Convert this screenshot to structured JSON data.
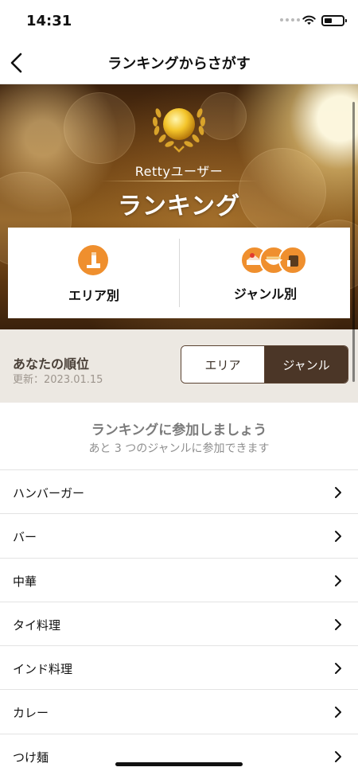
{
  "status_bar": {
    "time": "14:31"
  },
  "nav": {
    "title": "ランキングからさがす"
  },
  "hero": {
    "subtitle": "Rettyユーザー",
    "title": "ランキング",
    "choices": [
      {
        "label": "エリア別",
        "icon": "area-map-icon"
      },
      {
        "label": "ジャンル別",
        "icon": "food-genre-icon"
      }
    ]
  },
  "rank": {
    "title": "あなたの順位",
    "updated": "更新：2023.01.15",
    "tabs": [
      {
        "label": "エリア",
        "selected": false
      },
      {
        "label": "ジャンル",
        "selected": true
      }
    ]
  },
  "join": {
    "title": "ランキングに参加しましょう",
    "subtitle": "あと 3 つのジャンルに参加できます"
  },
  "genres": [
    {
      "label": "ハンバーガー"
    },
    {
      "label": "バー"
    },
    {
      "label": "中華"
    },
    {
      "label": "タイ料理"
    },
    {
      "label": "インド料理"
    },
    {
      "label": "カレー"
    },
    {
      "label": "つけ麺"
    }
  ],
  "colors": {
    "accent_orange": "#ef8f2e",
    "segment_dark": "#4b3627",
    "rank_bg": "#ece8e2"
  }
}
